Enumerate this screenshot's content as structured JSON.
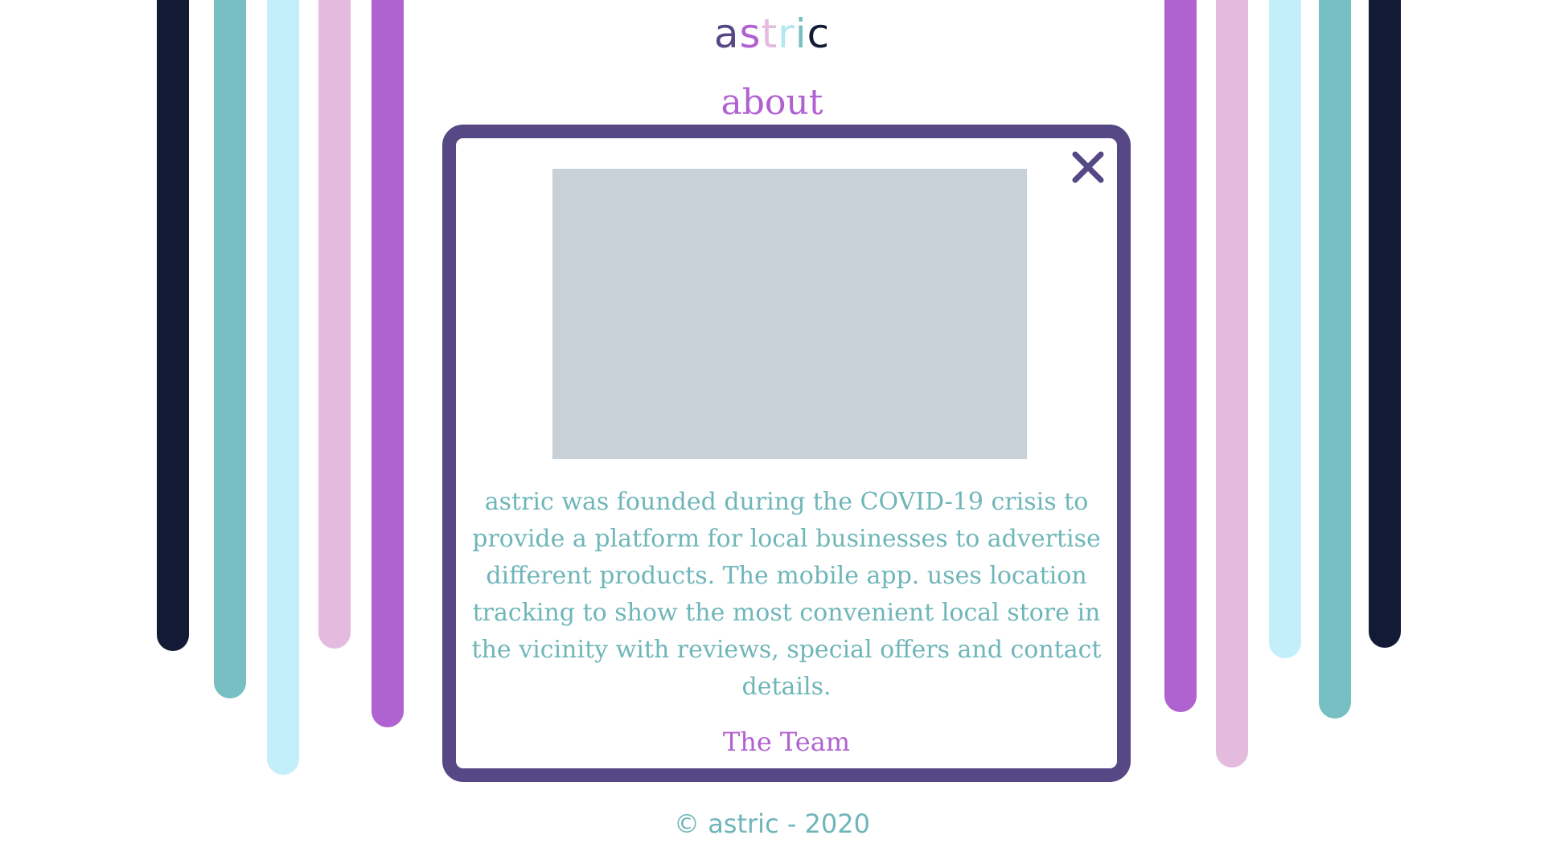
{
  "colors": {
    "navy": "#121a36",
    "teal": "#77bfc2",
    "light_blue": "#c2eff9",
    "pink": "#e4bade",
    "purple": "#b062d1",
    "dialog_border": "#554885",
    "image_placeholder": "#c8d0d8",
    "body_text": "#6fb6b9"
  },
  "header": {
    "logo": {
      "letters": [
        {
          "char": "a",
          "color": "#554885"
        },
        {
          "char": "s",
          "color": "#b062d1"
        },
        {
          "char": "t",
          "color": "#e4bade"
        },
        {
          "char": "r",
          "color": "#b4e7f2"
        },
        {
          "char": "i",
          "color": "#77bfc2"
        },
        {
          "char": "c",
          "color": "#121a36"
        }
      ]
    },
    "title": "about"
  },
  "dialog": {
    "close_icon": "close-icon",
    "body": "astric was founded during the COVID-19 crisis to provide a platform for local businesses to advertise different products. The mobile app. uses location tracking to show the most convenient local store in the vicinity with reviews, special offers and contact details.",
    "signature": "The Team"
  },
  "footer": {
    "copyright": "© astric - 2020"
  }
}
